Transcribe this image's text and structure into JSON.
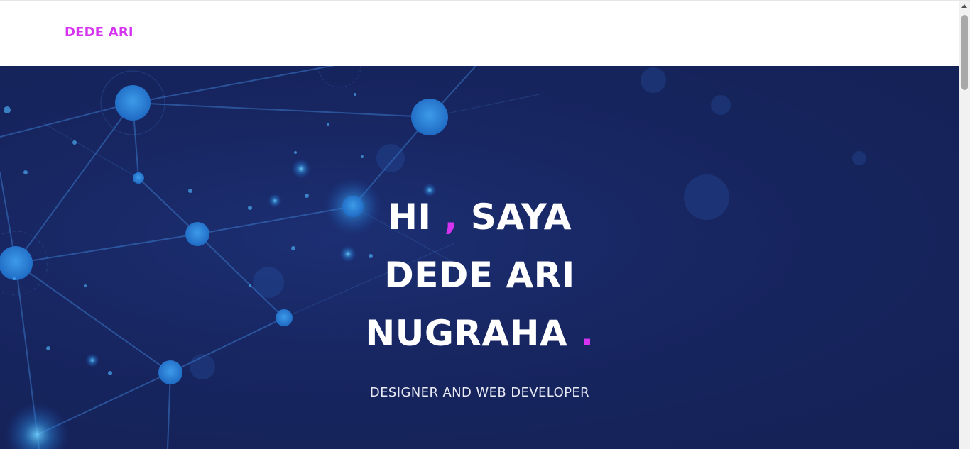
{
  "navbar": {
    "brand": "DEDE ARI"
  },
  "hero": {
    "line1_a": "HI",
    "line1_comma": ",",
    "line1_b": "SAYA",
    "line2": "DEDE ARI",
    "line3": "NUGRAHA",
    "line3_dot": ".",
    "subtitle": "DESIGNER AND WEB DEVELOPER"
  },
  "colors": {
    "accent": "#d633f0",
    "hero_background": "#172560",
    "headline": "#ffffff"
  }
}
